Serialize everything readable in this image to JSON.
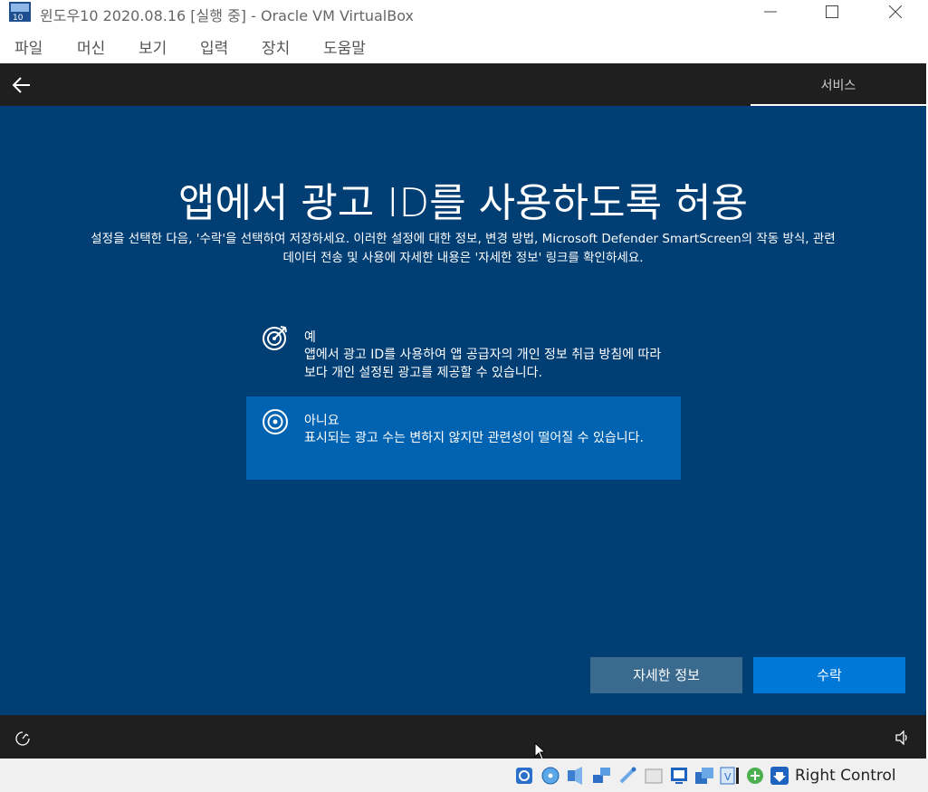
{
  "window": {
    "title": "윈도우10 2020.08.16 [실행 중] - Oracle VM VirtualBox",
    "menu": [
      "파일",
      "머신",
      "보기",
      "입력",
      "장치",
      "도움말"
    ]
  },
  "oobe": {
    "step_label": "서비스",
    "title": "앱에서 광고 ID를 사용하도록 허용",
    "subtitle_line1": "설정을 선택한 다음, '수락'을 선택하여 저장하세요. 이러한 설정에 대한 정보, 변경 방법, Microsoft Defender SmartScreen의 작동 방식, 관련",
    "subtitle_line2": "데이터 전송 및 사용에 자세한 내용은 '자세한 정보' 링크를 확인하세요.",
    "options": [
      {
        "title": "예",
        "description": "앱에서 광고 ID를 사용하여 앱 공급자의 개인 정보 취급 방침에 따라 보다 개인 설정된 광고를 제공할 수 있습니다.",
        "icon": "target-arrow-icon",
        "selected": false
      },
      {
        "title": "아니요",
        "description": "표시되는 광고 수는 변하지 않지만 관련성이 떨어질 수 있습니다.",
        "icon": "target-icon",
        "selected": true
      }
    ],
    "buttons": {
      "learn_more": "자세한 정보",
      "accept": "수락"
    }
  },
  "statusbar": {
    "host_key": "Right Control"
  },
  "colors": {
    "oobe_background": "#003e74",
    "selected_option": "#0063b1",
    "accept_button": "#0078d7",
    "learn_more_button": "#3b6a8f",
    "bar_background": "#1f1f1f"
  }
}
